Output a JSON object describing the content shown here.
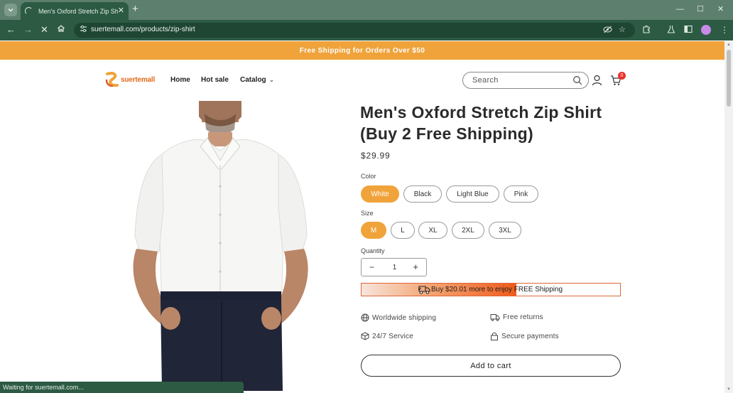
{
  "browser": {
    "tab_title": "Men's Oxford Stretch Zip Shirt (",
    "tab_close": "✕",
    "new_tab": "+",
    "url": "suertemall.com/products/zip-shirt",
    "status_text": "Waiting for suertemall.com..."
  },
  "store": {
    "announcement": "Free Shipping for Orders Over $50",
    "logo_text": "suertemall",
    "nav": [
      {
        "label": "Home"
      },
      {
        "label": "Hot sale"
      },
      {
        "label": "Catalog"
      }
    ],
    "search_placeholder": "Search",
    "cart_count": "0"
  },
  "product": {
    "title": "Men's Oxford Stretch Zip Shirt (Buy 2 Free Shipping)",
    "price": "$29.99",
    "color_label": "Color",
    "colors": [
      "White",
      "Black",
      "Light Blue",
      "Pink"
    ],
    "selected_color": "White",
    "size_label": "Size",
    "sizes": [
      "M",
      "L",
      "XL",
      "2XL",
      "3XL"
    ],
    "selected_size": "M",
    "quantity_label": "Quantity",
    "quantity": "1",
    "qty_minus": "−",
    "qty_plus": "+",
    "shipping_progress_text_a": "Buy $20.01 more to enjoy",
    "shipping_progress_text_b": " FREE Shipping",
    "shipping_progress_fraction": 0.6,
    "features": [
      "Worldwide shipping",
      "Free returns",
      "24/7 Service",
      "Secure payments"
    ],
    "add_to_cart": "Add to cart"
  },
  "colors": {
    "accent": "#f0a33a",
    "chrome_dark": "#2c5a43",
    "chrome_light": "#5d7f6e",
    "badge": "#e8302a"
  }
}
